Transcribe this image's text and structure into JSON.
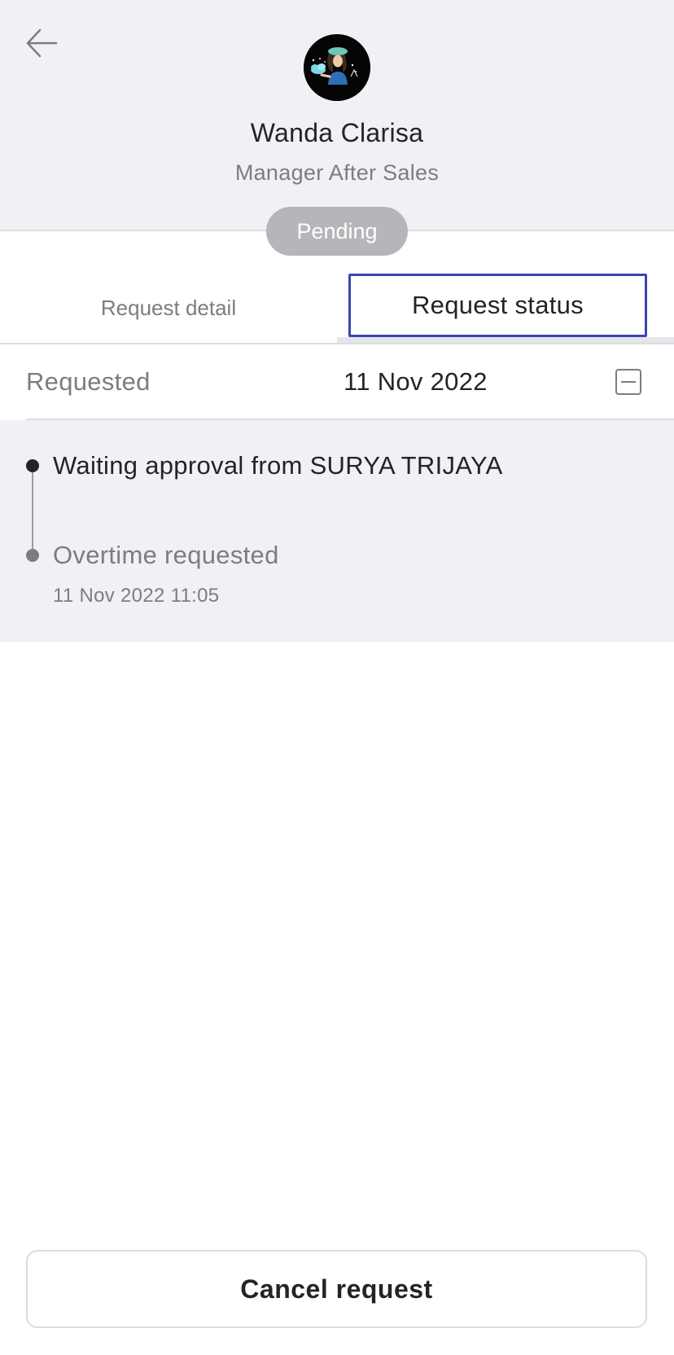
{
  "header": {
    "back_icon": "arrow-left-icon",
    "avatar_icon": "user-avatar-illustration",
    "name": "Wanda Clarisa",
    "role": "Manager After Sales",
    "status_badge": "Pending"
  },
  "tabs": [
    {
      "label": "Request detail",
      "selected": false
    },
    {
      "label": "Request status",
      "selected": true
    }
  ],
  "requested": {
    "label": "Requested",
    "date": "11 Nov 2022",
    "toggle_icon": "collapse-icon"
  },
  "timeline": [
    {
      "title": "Waiting approval from SURYA TRIJAYA",
      "time": ""
    },
    {
      "title": "Overtime requested",
      "time": "11 Nov 2022 11:05"
    }
  ],
  "footer": {
    "cancel_label": "Cancel request"
  },
  "colors": {
    "header_bg": "#f0f1f5",
    "badge_bg": "#b5b6b9",
    "focus_border": "#3b45b3",
    "text_primary": "#222428",
    "text_secondary": "#7b7d82"
  }
}
